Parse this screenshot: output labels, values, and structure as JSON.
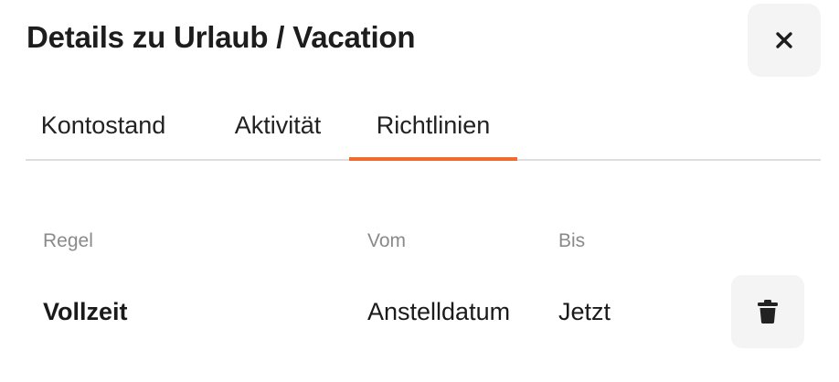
{
  "dialog": {
    "title": "Details zu Urlaub / Vacation",
    "close_icon": "close-icon"
  },
  "tabs": [
    {
      "label": "Kontostand",
      "active": false
    },
    {
      "label": "Aktivität",
      "active": false
    },
    {
      "label": "Richtlinien",
      "active": true
    }
  ],
  "table": {
    "headers": {
      "rule": "Regel",
      "from": "Vom",
      "to": "Bis"
    },
    "rows": [
      {
        "rule": "Vollzeit",
        "from": "Anstelldatum",
        "to": "Jetzt",
        "action_icon": "trash-icon"
      }
    ]
  },
  "colors": {
    "accent": "#f26a2e",
    "button_bg": "#f4f4f4",
    "divider": "#dedede",
    "muted_text": "#8a8a8a"
  }
}
